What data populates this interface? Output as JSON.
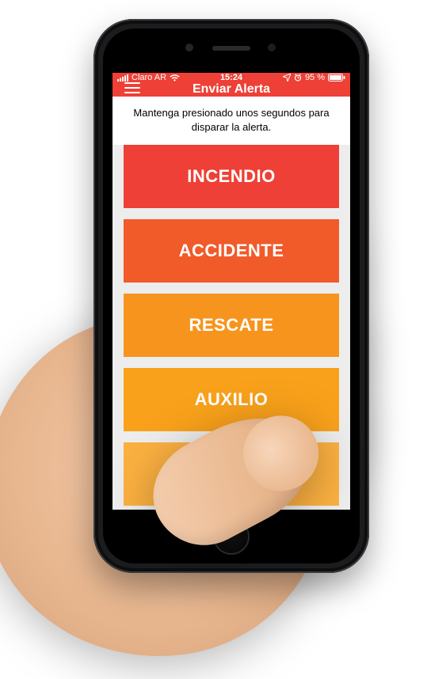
{
  "statusbar": {
    "carrier": "Claro AR",
    "time": "15:24",
    "battery": "95 %"
  },
  "header": {
    "title": "Enviar Alerta"
  },
  "instruction": "Mantenga presionado unos segundos para disparar la alerta.",
  "alerts": [
    {
      "label": "INCENDIO"
    },
    {
      "label": "ACCIDENTE"
    },
    {
      "label": "RESCATE"
    },
    {
      "label": "AUXILIO"
    },
    {
      "label": ""
    }
  ]
}
